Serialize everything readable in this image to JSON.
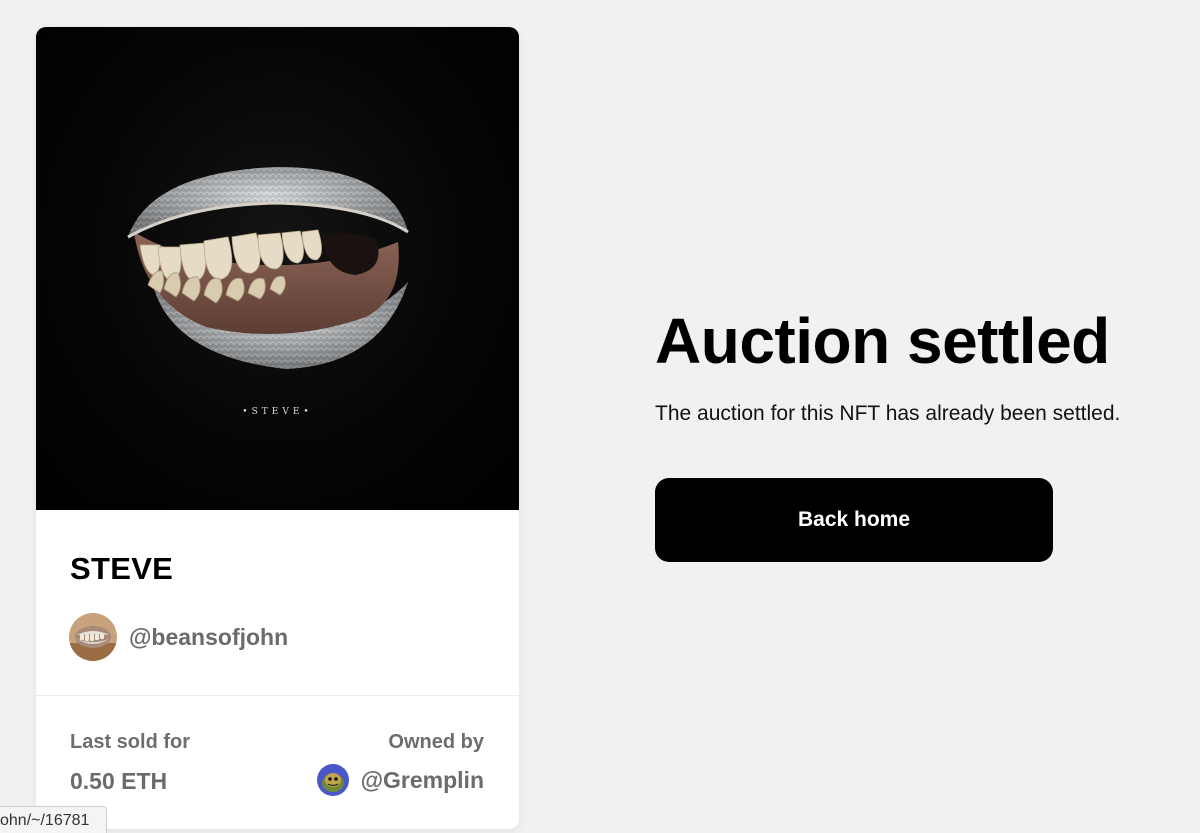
{
  "nft": {
    "title": "STEVE",
    "art_caption": "•STEVE•",
    "creator_handle": "@beansofjohn",
    "last_sold_label": "Last sold for",
    "last_sold_value": "0.50 ETH",
    "owned_by_label": "Owned by",
    "owner_handle": "@Gremplin"
  },
  "main": {
    "headline": "Auction settled",
    "message": "The auction for this NFT has already been settled.",
    "back_button_label": "Back home"
  },
  "status_bar": {
    "url": "ohn/~/16781"
  },
  "colors": {
    "page_background": "#f1f1f1",
    "card_background": "#ffffff",
    "button_background": "#000000",
    "button_text": "#ffffff",
    "muted_text": "#6b6b6b",
    "owner_avatar_accent": "#4a57c9"
  },
  "icons": {
    "creator_avatar": "teeth-shell-avatar-icon",
    "owner_avatar": "gremlin-avatar-icon"
  }
}
